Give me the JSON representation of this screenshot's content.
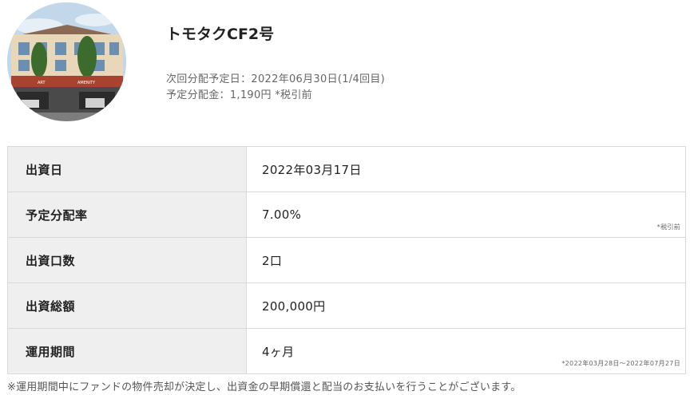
{
  "fund": {
    "title": "トモタクCF2号",
    "next_distribution_label": "次回分配予定日：",
    "next_distribution_date": "2022年06月30日(1/4回目)",
    "planned_amount_label": "予定分配金：",
    "planned_amount": "1,190円 *税引前",
    "building_sign_left": "ART",
    "building_sign_right": "AMENITY"
  },
  "details": [
    {
      "label": "出資日",
      "value": "2022年03月17日",
      "note": ""
    },
    {
      "label": "予定分配率",
      "value": "7.00%",
      "note": "*税引前"
    },
    {
      "label": "出資口数",
      "value": "2口",
      "note": ""
    },
    {
      "label": "出資総額",
      "value": "200,000円",
      "note": ""
    },
    {
      "label": "運用期間",
      "value": "4ヶ月",
      "note": "*2022年03月28日～2022年07月27日"
    }
  ],
  "footnote": "※運用期間中にファンドの物件売却が決定し、出資金の早期償還と配当のお支払いを行うことがございます。",
  "colors": {
    "label_bg": "#efefef",
    "border": "#d9d9d9",
    "sky": "#b9cfe4"
  }
}
